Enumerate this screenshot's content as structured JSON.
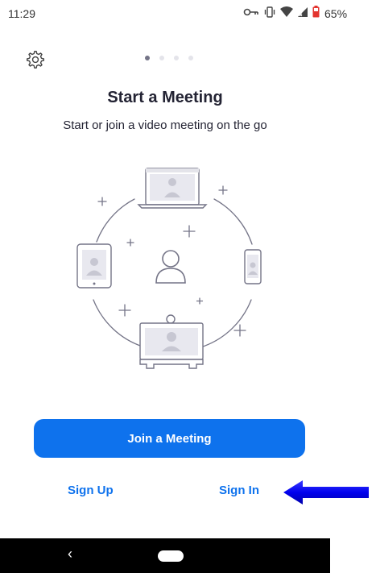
{
  "status_bar": {
    "time": "11:29",
    "battery": "65%",
    "icons": [
      "vpn-key-icon",
      "vibrate-icon",
      "wifi-icon",
      "signal-icon",
      "battery-icon"
    ]
  },
  "header": {
    "pager_count": 4,
    "pager_active": 0
  },
  "main": {
    "title": "Start a Meeting",
    "subtitle": "Start or join a video meeting on the go",
    "illustration": "video-meeting-devices-illustration"
  },
  "actions": {
    "join_label": "Join a Meeting",
    "sign_up_label": "Sign Up",
    "sign_in_label": "Sign In"
  },
  "nav_bar": {
    "back_glyph": "‹",
    "icons": [
      "back-icon",
      "home-pill-icon"
    ]
  },
  "colors": {
    "accent": "#0e72ed",
    "text": "#232333",
    "annotation_arrow": "#0000ff"
  }
}
